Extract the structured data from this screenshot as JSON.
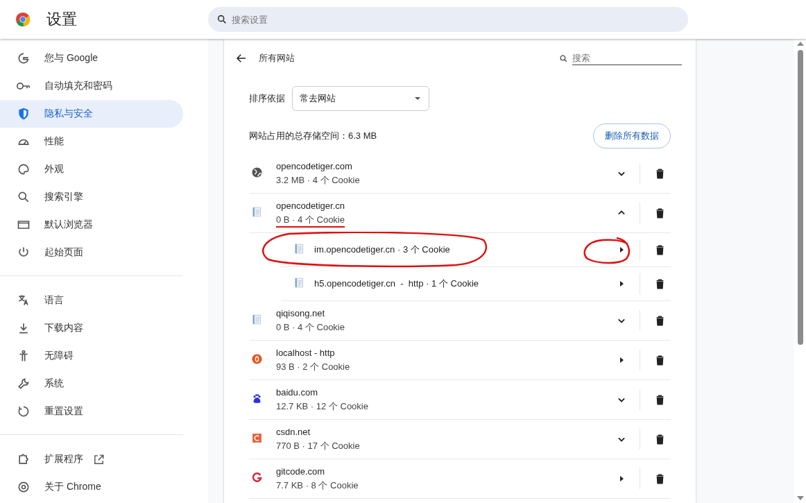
{
  "header": {
    "title": "设置",
    "search": {
      "placeholder": "搜索设置"
    }
  },
  "sidebar": {
    "sections": [
      [
        {
          "label": "您与 Google",
          "selected": false
        },
        {
          "label": "自动填充和密码",
          "selected": false
        },
        {
          "label": "隐私与安全",
          "selected": true
        },
        {
          "label": "性能",
          "selected": false
        },
        {
          "label": "外观",
          "selected": false
        },
        {
          "label": "搜索引擎",
          "selected": false
        },
        {
          "label": "默认浏览器",
          "selected": false
        },
        {
          "label": "起始页面",
          "selected": false
        }
      ],
      [
        {
          "label": "语言",
          "selected": false
        },
        {
          "label": "下载内容",
          "selected": false
        },
        {
          "label": "无障碍",
          "selected": false
        },
        {
          "label": "系统",
          "selected": false
        },
        {
          "label": "重置设置",
          "selected": false
        }
      ],
      [
        {
          "label": "扩展程序",
          "selected": false,
          "external": true
        },
        {
          "label": "关于 Chrome",
          "selected": false
        }
      ]
    ]
  },
  "page": {
    "title": "所有网站",
    "search": {
      "placeholder": "搜索"
    },
    "sort": {
      "label": "排序依据",
      "value": "常去网站"
    },
    "storage": "网站占用的总存储空间：6.3 MB",
    "delete_all": "删除所有数据",
    "sites": [
      {
        "kind": "group",
        "name": "opencodetiger.com",
        "detail": "3.2 MB · 4 个 Cookie",
        "expanded": false
      },
      {
        "kind": "group",
        "name": "opencodetiger.cn",
        "detail": "0 B · 4 个 Cookie",
        "expanded": true,
        "underlined": true,
        "children": [
          {
            "name": "im.opencodetiger.cn · 3 个 Cookie",
            "circled": true
          },
          {
            "name": "h5.opencodetiger.cn  -  http · 1 个 Cookie",
            "circled": false
          }
        ]
      },
      {
        "kind": "group",
        "name": "qiqisong.net",
        "detail": "0 B · 4 个 Cookie",
        "expanded": false
      },
      {
        "kind": "single",
        "name": "localhost - http",
        "detail": "93 B · 2 个 Cookie"
      },
      {
        "kind": "group",
        "name": "baidu.com",
        "detail": "12.7 KB · 12 个 Cookie",
        "expanded": false
      },
      {
        "kind": "group",
        "name": "csdn.net",
        "detail": "770 B · 17 个 Cookie",
        "expanded": false
      },
      {
        "kind": "single",
        "name": "gitcode.com",
        "detail": "7.7 KB · 8 个 Cookie"
      }
    ]
  }
}
